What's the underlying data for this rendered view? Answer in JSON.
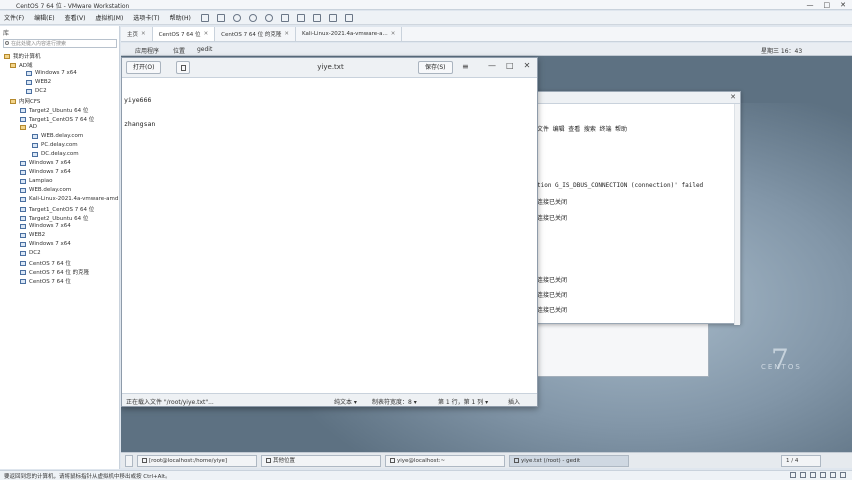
{
  "app": {
    "title": "CentOS 7 64 位 - VMware Workstation",
    "controls": [
      "—",
      "□",
      "✕"
    ]
  },
  "menu": {
    "items": [
      "文件(F)",
      "编辑(E)",
      "查看(V)",
      "虚拟机(M)",
      "选项卡(T)",
      "帮助(H)"
    ]
  },
  "sidebar": {
    "title": "库",
    "search_placeholder": "在此处键入内容进行搜索",
    "items": [
      {
        "label": "我的计算机",
        "type": "folder"
      },
      {
        "label": "AD域",
        "type": "folder"
      },
      {
        "label": "Windows 7 x64",
        "type": "vm"
      },
      {
        "label": "WEB2",
        "type": "vm"
      },
      {
        "label": "DC2",
        "type": "vm"
      },
      {
        "label": "内网CFS",
        "type": "folder"
      },
      {
        "label": "Target2_Ubuntu 64 位",
        "type": "vm"
      },
      {
        "label": "Target1_CentOS 7 64 位",
        "type": "vm"
      },
      {
        "label": "AD",
        "type": "folder"
      },
      {
        "label": "WEB.delay.com",
        "type": "vm"
      },
      {
        "label": "PC.delay.com",
        "type": "vm"
      },
      {
        "label": "DC.delay.com",
        "type": "vm"
      },
      {
        "label": "Windows 7 x64",
        "type": "vm"
      },
      {
        "label": "Windows 7 x64",
        "type": "vm"
      },
      {
        "label": "Lampiao",
        "type": "vm"
      },
      {
        "label": "WEB.delay.com",
        "type": "vm"
      },
      {
        "label": "Kali-Linux-2021.4a-vmware-amd",
        "type": "vm"
      },
      {
        "label": "Target1_CentOS 7 64 位",
        "type": "vm"
      },
      {
        "label": "Target2_Ubuntu 64 位",
        "type": "vm"
      },
      {
        "label": "Windows 7 x64",
        "type": "vm"
      },
      {
        "label": "WEB2",
        "type": "vm"
      },
      {
        "label": "Windows 7 x64",
        "type": "vm"
      },
      {
        "label": "DC2",
        "type": "vm"
      },
      {
        "label": "CentOS 7 64 位",
        "type": "vm"
      },
      {
        "label": "CentOS 7 64 位 的克隆",
        "type": "vm"
      },
      {
        "label": "CentOS 7 64 位",
        "type": "vm"
      }
    ]
  },
  "vm_tabs": [
    {
      "label": "主页",
      "active": false
    },
    {
      "label": "CentOS 7 64 位",
      "active": true
    },
    {
      "label": "CentOS 7 64 位 的克隆",
      "active": false
    },
    {
      "label": "Kali-Linux-2021.4a-vmware-a...",
      "active": false
    }
  ],
  "gnome": {
    "apps_menu": "应用程序",
    "places_menu": "位置",
    "active_app": "gedit",
    "clock": "星期三 16：43"
  },
  "gedit": {
    "open_label": "打开(O)",
    "title": "yiye.txt",
    "save_label": "保存(S)",
    "menu_icon": "≡",
    "controls": [
      "—",
      "□",
      "✕"
    ],
    "lines": [
      "yiye666",
      "zhangsan"
    ],
    "status": {
      "loading": "正在载入文件 \"/root/yiye.txt\"...",
      "mode": "纯文本 ▾",
      "tab_width": "制表符宽度：8 ▾",
      "position": "第 1 行，第 1 列 ▾",
      "insert": "插入"
    }
  },
  "terminal": {
    "menu": "文件(F) 编辑(E) 查看(V) 搜索(S) 终端(T) 帮助(H)",
    "lines": [
      "文件  编辑  查看  搜索  终端  帮助",
      "tion  G_IS_DBUS_CONNECTION (connection)' failed",
      "连接已关闭",
      "连接已关闭",
      "连接已关闭",
      "连接已关闭",
      "连接已关闭"
    ]
  },
  "guest_taskbar": {
    "items": [
      {
        "label": "[root@localhost:/home/yiye]",
        "active": false
      },
      {
        "label": "其他位置",
        "active": false
      },
      {
        "label": "yiye@localhost:~",
        "active": false
      },
      {
        "label": "yiye.txt (/root) - gedit",
        "active": true
      }
    ],
    "pager": "1 / 4"
  },
  "statusbar": {
    "hint": "要返回到您的计算机，请将鼠标指针从虚拟机中移出或按 Ctrl+Alt。"
  },
  "desktop": {
    "logo_number": "7",
    "logo_text": "CENTOS"
  }
}
